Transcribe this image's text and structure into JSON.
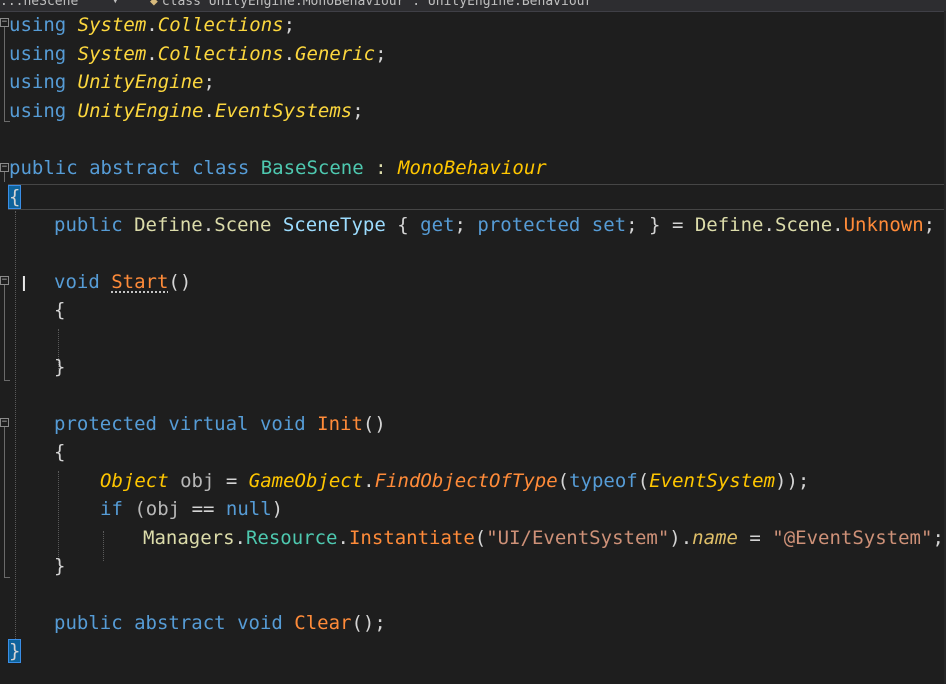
{
  "navbar": {
    "left_label": "...neScene",
    "dropdown_icon": "chevron-down-icon",
    "class_icon": "class-icon",
    "member_label": "class UnityEngine.MonoBehaviour : UnityEngine.Behaviour"
  },
  "code": {
    "l1": [
      "using",
      "System",
      ".",
      "Collections",
      ";"
    ],
    "l2": [
      "using",
      "System",
      ".",
      "Collections",
      ".",
      "Generic",
      ";"
    ],
    "l3": [
      "using",
      "UnityEngine",
      ";"
    ],
    "l4": [
      "using",
      "UnityEngine",
      ".",
      "EventSystems",
      ";"
    ],
    "l6": [
      "public",
      "abstract",
      "class",
      "BaseScene",
      ":",
      "MonoBehaviour"
    ],
    "l7": [
      "{"
    ],
    "l8": [
      "public",
      "Define",
      ".",
      "Scene",
      "SceneType",
      "{",
      "get",
      ";",
      "protected",
      "set",
      ";",
      "}",
      "=",
      "Define",
      ".",
      "Scene",
      ".",
      "Unknown",
      ";"
    ],
    "l10": [
      "void",
      "Start",
      "()"
    ],
    "l11": [
      "{"
    ],
    "l13": [
      "}"
    ],
    "l15": [
      "protected",
      "virtual",
      "void",
      "Init",
      "()"
    ],
    "l16": [
      "{"
    ],
    "l17": [
      "Object",
      "obj",
      "=",
      "GameObject",
      ".",
      "FindObjectOfType",
      "(",
      "typeof",
      "(",
      "EventSystem",
      "));"
    ],
    "l18": [
      "if",
      "(obj",
      "==",
      "null",
      ")"
    ],
    "l19": [
      "Managers",
      ".",
      "Resource",
      ".",
      "Instantiate",
      "(",
      "\"UI/EventSystem\"",
      ").",
      "name",
      "=",
      "\"@EventSystem\"",
      ";"
    ],
    "l20": [
      "}"
    ],
    "l22": [
      "public",
      "abstract",
      "void",
      "Clear",
      "();"
    ],
    "l23": [
      "}"
    ]
  },
  "colors": {
    "background": "#1e1e1e",
    "keyword": "#569cd6",
    "type": "#4ec9b0",
    "method": "#ff8b39",
    "string": "#ce9178"
  }
}
